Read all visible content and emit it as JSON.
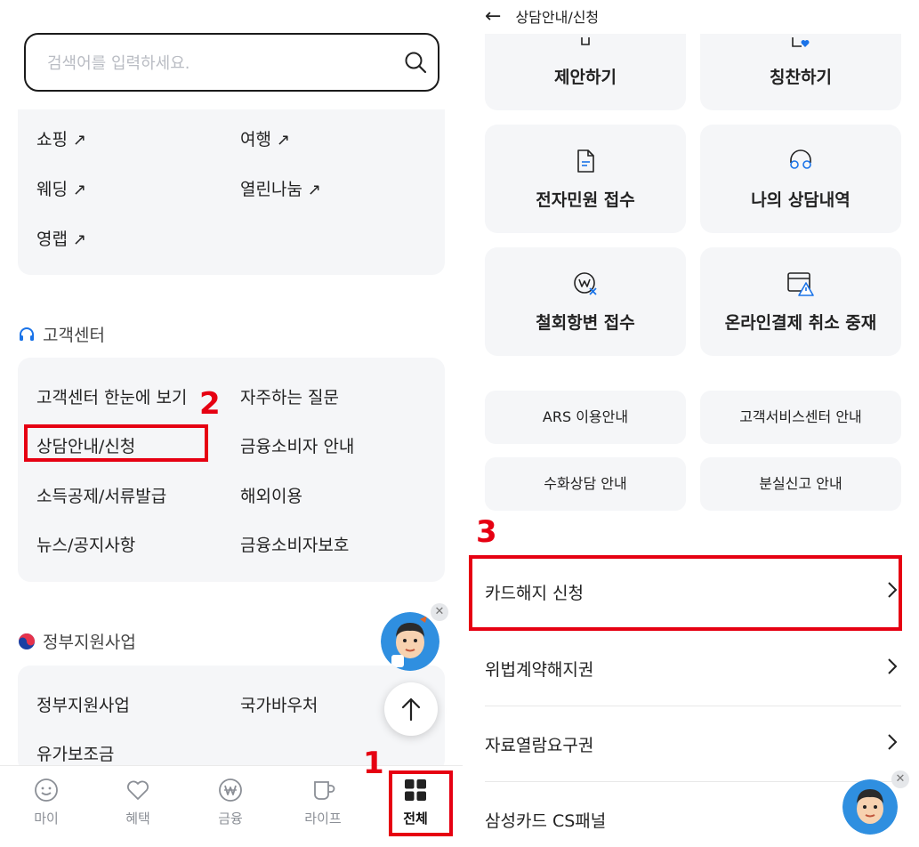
{
  "search": {
    "placeholder": "검색어를 입력하세요."
  },
  "links": {
    "shopping": "쇼핑",
    "travel": "여행",
    "wedding": "웨딩",
    "open_sharing": "열린나눔",
    "young_lab": "영랩",
    "arrow": "↗"
  },
  "customer_center": {
    "title": "고객센터",
    "items": {
      "overview": "고객센터 한눈에 보기",
      "faq": "자주하는 질문",
      "consult": "상담안내/신청",
      "consumer_guide": "금융소비자 안내",
      "tax": "소득공제/서류발급",
      "overseas": "해외이용",
      "news": "뉴스/공지사항",
      "consumer_protect": "금융소비자보호"
    }
  },
  "gov": {
    "title": "정부지원사업",
    "items": {
      "gov_support": "정부지원사업",
      "voucher": "국가바우처",
      "fuel": "유가보조금"
    }
  },
  "annotations": {
    "step1": "1",
    "step2": "2",
    "step3": "3"
  },
  "tabbar": {
    "my": "마이",
    "benefit": "혜택",
    "finance": "금융",
    "life": "라이프",
    "all": "전체"
  },
  "right_panel": {
    "header_title": "상담안내/신청",
    "back_arrow": "←",
    "tiles": {
      "suggest": "제안하기",
      "praise": "칭찬하기",
      "e_petition": "전자민원 접수",
      "my_history": "나의 상담내역",
      "withdraw": "철회항변 접수",
      "online_cancel": "온라인결제 취소 중재"
    },
    "small_tiles": {
      "ars": "ARS 이용안내",
      "service_center": "고객서비스센터 안내",
      "sign_language": "수화상담 안내",
      "lost_report": "분실신고 안내"
    },
    "rows": {
      "card_cancel": "카드해지 신청",
      "illegal_contract": "위법계약해지권",
      "data_request": "자료열람요구권",
      "cs_panel": "삼성카드 CS패널"
    }
  },
  "colors": {
    "accent_red": "#e60012",
    "card_bg": "#f5f6f8",
    "icon_blue": "#1a73e8"
  }
}
